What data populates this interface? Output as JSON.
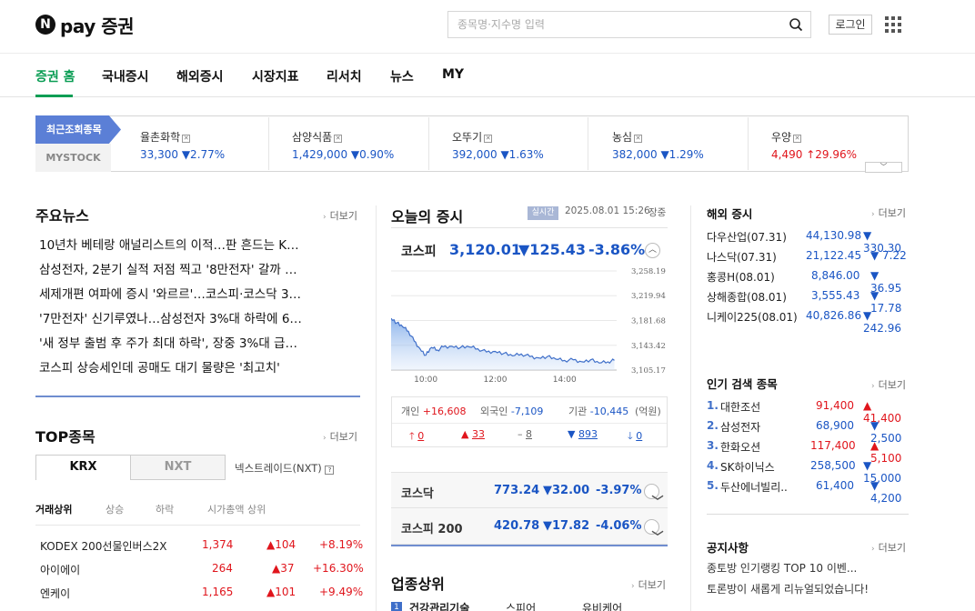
{
  "header": {
    "logo_mark": "N",
    "logo_text": "pay 증권",
    "search_placeholder": "종목명·지수명 입력",
    "login_label": "로그인"
  },
  "nav": {
    "items": [
      "증권 홈",
      "국내증시",
      "해외증시",
      "시장지표",
      "리서치",
      "뉴스",
      "MY"
    ]
  },
  "recent": {
    "label": "최근조회종목",
    "mystock_label": "MYSTOCK",
    "items": [
      {
        "name": "율촌화학",
        "price": "33,300",
        "change": "▼2.77%",
        "dir": "down"
      },
      {
        "name": "삼양식품",
        "price": "1,429,000",
        "change": "▼0.90%",
        "dir": "down"
      },
      {
        "name": "오뚜기",
        "price": "392,000",
        "change": "▼1.63%",
        "dir": "down"
      },
      {
        "name": "농심",
        "price": "382,000",
        "change": "▼1.29%",
        "dir": "down"
      },
      {
        "name": "우양",
        "price": "4,490",
        "change": "↑29.96%",
        "dir": "up"
      }
    ]
  },
  "news": {
    "title": "주요뉴스",
    "more": "더보기",
    "items": [
      "10년차 베테랑 애널리스트의 이적…판 흔드는 K…",
      "삼성전자, 2분기 실적 저점 찍고 '8만전자' 갈까 …",
      "세제개편 여파에 증시 '와르르'…코스피·코스닥 3…",
      "'7만전자' 신기루였나…삼성전자 3%대 하락에 6…",
      "'새 정부 출범 후 주가 최대 하락', 장중 3%대 급…",
      "코스피 상승세인데 공매도 대기 물량은 '최고치'"
    ]
  },
  "top_stocks": {
    "title": "TOP종목",
    "more": "더보기",
    "tabs": [
      "KRX",
      "NXT"
    ],
    "nxt_note": "넥스트레이드(NXT)",
    "subtabs": [
      "거래상위",
      "상승",
      "하락",
      "시가총액 상위"
    ],
    "rows": [
      {
        "name": "KODEX 200선물인버스2X",
        "price": "1,374",
        "change": "▲104",
        "rate": "+8.19%"
      },
      {
        "name": "아이에이",
        "price": "264",
        "change": "▲37",
        "rate": "+16.30%"
      },
      {
        "name": "엔케이",
        "price": "1,165",
        "change": "▲101",
        "rate": "+9.49%"
      }
    ]
  },
  "market": {
    "title": "오늘의 증시",
    "live": "실시간",
    "datetime": "2025.08.01 15:26",
    "status": "장중",
    "kospi": {
      "name": "코스피",
      "value": "3,120.01",
      "change": "▼125.43",
      "rate": "-3.86%"
    },
    "flow": {
      "individual_label": "개인",
      "individual": "+16,608",
      "foreign_label": "외국인",
      "foreign": "-7,109",
      "inst_label": "기관",
      "inst": "-10,445",
      "unit": "(억원)"
    },
    "breadth": {
      "upper": "0",
      "up": "33",
      "flat": "8",
      "down": "893",
      "lower": "0"
    },
    "kosdaq": {
      "name": "코스닥",
      "value": "773.24",
      "change": "▼32.00",
      "rate": "-3.97%"
    },
    "kospi200": {
      "name": "코스피 200",
      "value": "420.78",
      "change": "▼17.82",
      "rate": "-4.06%"
    }
  },
  "chart_data": {
    "type": "area",
    "title": "",
    "xlabel": "",
    "ylabel": "",
    "x_ticks": [
      "10:00",
      "12:00",
      "14:00"
    ],
    "y_ticks": [
      "3,258.19",
      "3,219.94",
      "3,181.68",
      "3,143.42",
      "3,105.17"
    ],
    "ylim": [
      3105.17,
      3258.19
    ],
    "time_range": [
      "09:00",
      "15:30"
    ],
    "series": [
      {
        "x": [
          "09:00",
          "09:10",
          "09:20",
          "09:30",
          "09:40",
          "09:50",
          "10:00",
          "10:10",
          "10:20",
          "10:30",
          "10:45",
          "11:00",
          "11:15",
          "11:30",
          "11:45",
          "12:00",
          "12:15",
          "12:30",
          "12:45",
          "13:00",
          "13:15",
          "13:30",
          "13:45",
          "14:00",
          "14:15",
          "14:30",
          "14:45",
          "15:00",
          "15:15",
          "15:26"
        ],
        "values": [
          3185,
          3178,
          3172,
          3165,
          3150,
          3138,
          3128,
          3140,
          3136,
          3141,
          3142,
          3140,
          3141,
          3138,
          3133,
          3134,
          3131,
          3127,
          3130,
          3126,
          3124,
          3126,
          3122,
          3120,
          3121,
          3118,
          3121,
          3116,
          3118,
          3120
        ]
      }
    ],
    "grid": true,
    "fill": "gradient-blue"
  },
  "sectors": {
    "title": "업종상위",
    "more": "더보기",
    "first": {
      "rank": "1",
      "name": "건강관리기술",
      "col2": "스피어",
      "col3": "유비케어"
    }
  },
  "overseas": {
    "title": "해외 증시",
    "more": "더보기",
    "rows": [
      {
        "name": "다우산업(07.31)",
        "value": "44,130.98",
        "change": "▼ 330.30"
      },
      {
        "name": "나스닥(07.31)",
        "value": "21,122.45",
        "change": "▼ 7.22"
      },
      {
        "name": "홍콩H(08.01)",
        "value": "8,846.00",
        "change": "▼ 36.95"
      },
      {
        "name": "상해종합(08.01)",
        "value": "3,555.43",
        "change": "▼ 17.78"
      },
      {
        "name": "니케이225(08.01)",
        "value": "40,826.86",
        "change": "▼ 242.96"
      }
    ]
  },
  "popular": {
    "title": "인기 검색 종목",
    "more": "더보기",
    "rows": [
      {
        "rank": "1.",
        "name": "대한조선",
        "price": "91,400",
        "change": "▲ 41,400",
        "dir": "up"
      },
      {
        "rank": "2.",
        "name": "삼성전자",
        "price": "68,900",
        "change": "▼ 2,500",
        "dir": "down"
      },
      {
        "rank": "3.",
        "name": "한화오션",
        "price": "117,400",
        "change": "▲ 5,100",
        "dir": "up"
      },
      {
        "rank": "4.",
        "name": "SK하이닉스",
        "price": "258,500",
        "change": "▼ 15,000",
        "dir": "down"
      },
      {
        "rank": "5.",
        "name": "두산에너빌리..",
        "price": "61,400",
        "change": "▼ 4,200",
        "dir": "down"
      }
    ]
  },
  "notice": {
    "title": "공지사항",
    "more": "더보기",
    "items": [
      "종토방 인기랭킹 TOP 10 이벤...",
      "토론방이 새롭게 리뉴얼되었습니다!"
    ]
  }
}
